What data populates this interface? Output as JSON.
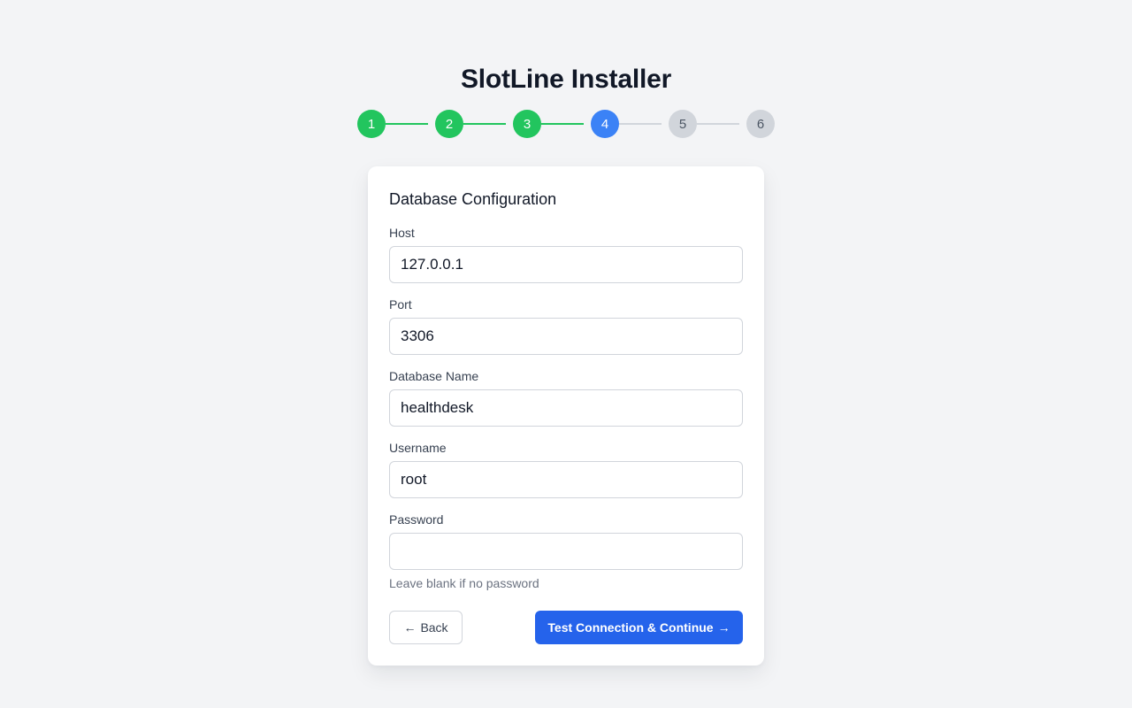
{
  "app": {
    "title": "SlotLine Installer"
  },
  "stepper": {
    "steps": [
      {
        "label": "1",
        "status": "done"
      },
      {
        "label": "2",
        "status": "done"
      },
      {
        "label": "3",
        "status": "done"
      },
      {
        "label": "4",
        "status": "active"
      },
      {
        "label": "5",
        "status": "todo"
      },
      {
        "label": "6",
        "status": "todo"
      }
    ],
    "colors": {
      "done": "#22c55e",
      "active": "#3b82f6",
      "todo": "#d1d5db"
    }
  },
  "form": {
    "title": "Database Configuration",
    "fields": {
      "host": {
        "label": "Host",
        "value": "127.0.0.1"
      },
      "port": {
        "label": "Port",
        "value": "3306"
      },
      "database": {
        "label": "Database Name",
        "value": "healthdesk"
      },
      "username": {
        "label": "Username",
        "value": "root"
      },
      "password": {
        "label": "Password",
        "value": "",
        "hint": "Leave blank if no password"
      }
    }
  },
  "actions": {
    "back_label": "Back",
    "back_icon": "arrow-left-icon",
    "back_glyph": "←",
    "continue_label": "Test Connection & Continue",
    "continue_icon": "arrow-right-icon",
    "continue_glyph": "→",
    "primary_color": "#2563eb"
  }
}
